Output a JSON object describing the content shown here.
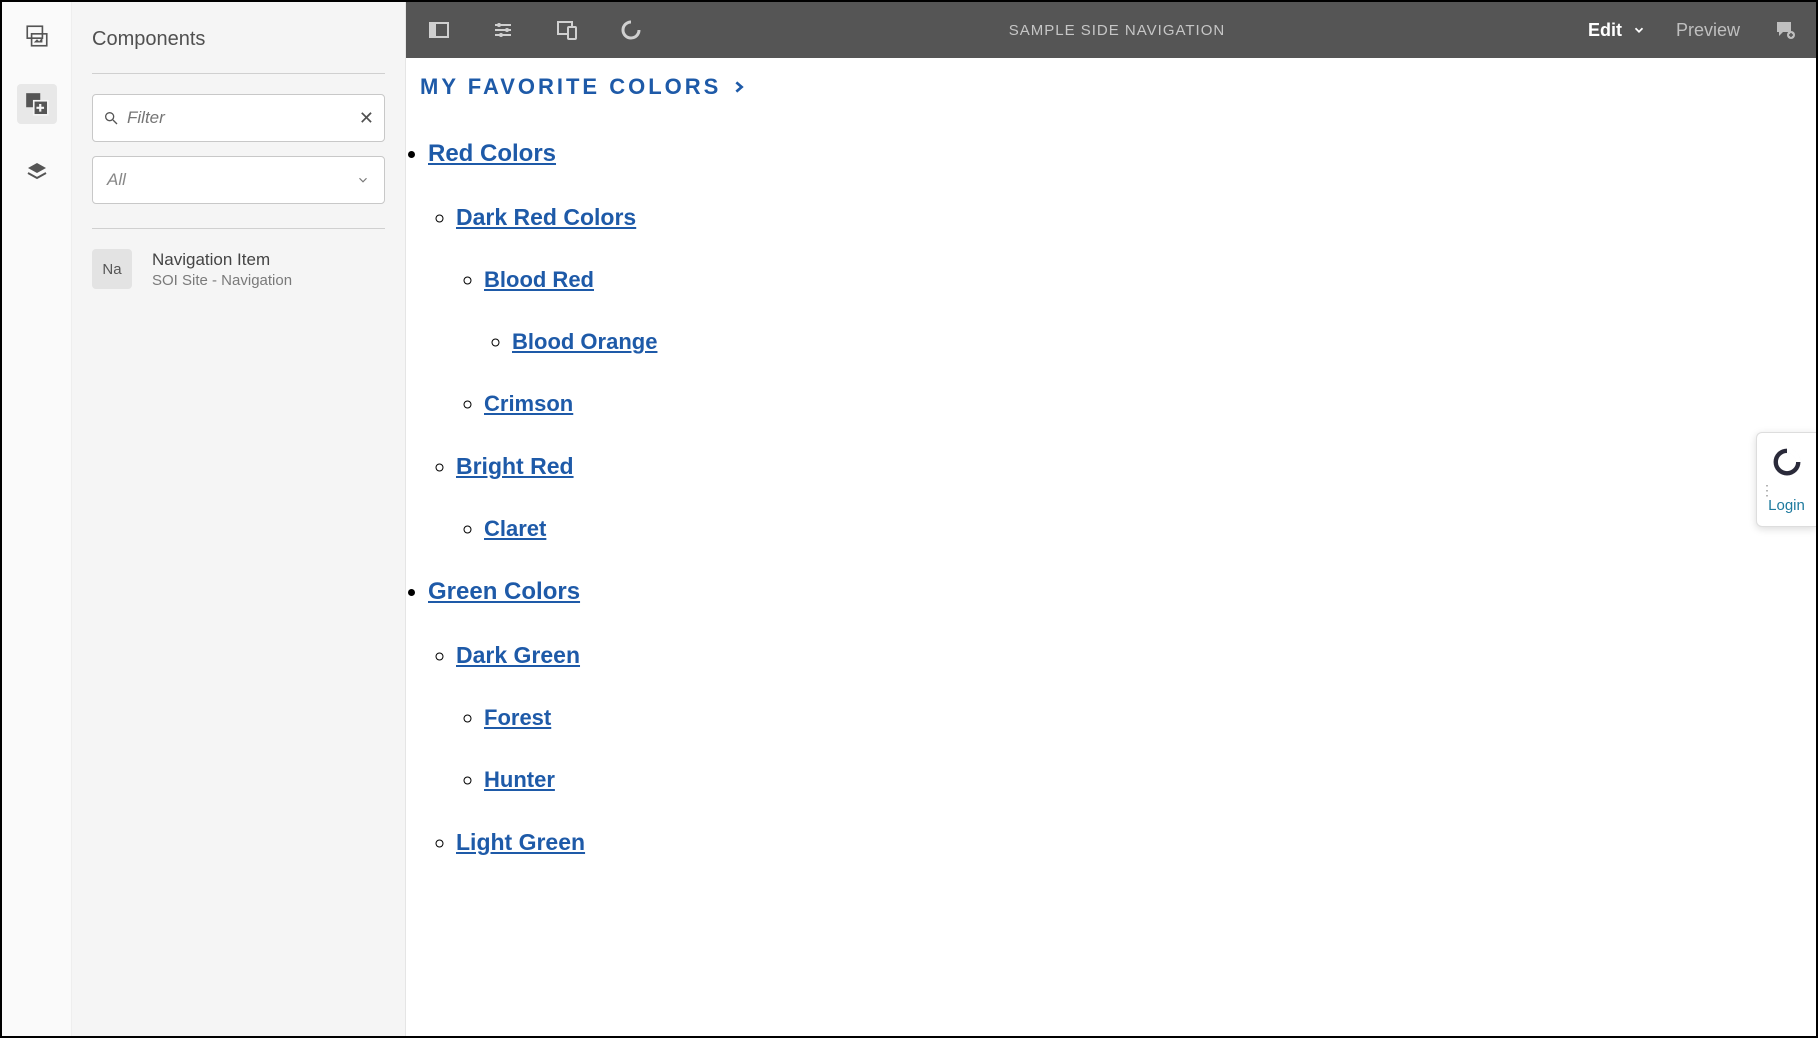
{
  "rail": {
    "buttons": [
      "assets-icon",
      "components-icon",
      "content-tree-icon"
    ],
    "activeIndex": 1
  },
  "panel": {
    "title": "Components",
    "filter": {
      "placeholder": "Filter"
    },
    "typeSelect": {
      "value": "All"
    },
    "components": [
      {
        "abbr": "Na",
        "title": "Navigation Item",
        "subtitle": "SOI Site - Navigation"
      }
    ]
  },
  "topbar": {
    "title": "SAMPLE SIDE NAVIGATION",
    "mode": "Edit",
    "preview": "Preview"
  },
  "page": {
    "heading": "MY FAVORITE COLORS",
    "tree": [
      {
        "label": "Red Colors",
        "children": [
          {
            "label": "Dark Red Colors",
            "children": [
              {
                "label": "Blood Red",
                "children": [
                  {
                    "label": "Blood Orange"
                  }
                ]
              },
              {
                "label": "Crimson"
              }
            ]
          },
          {
            "label": "Bright Red",
            "children": [
              {
                "label": "Claret"
              }
            ]
          }
        ]
      },
      {
        "label": "Green Colors",
        "children": [
          {
            "label": "Dark Green",
            "children": [
              {
                "label": "Forest"
              },
              {
                "label": "Hunter"
              }
            ]
          },
          {
            "label": "Light Green"
          }
        ]
      }
    ]
  },
  "loginWidget": {
    "label": "Login"
  }
}
